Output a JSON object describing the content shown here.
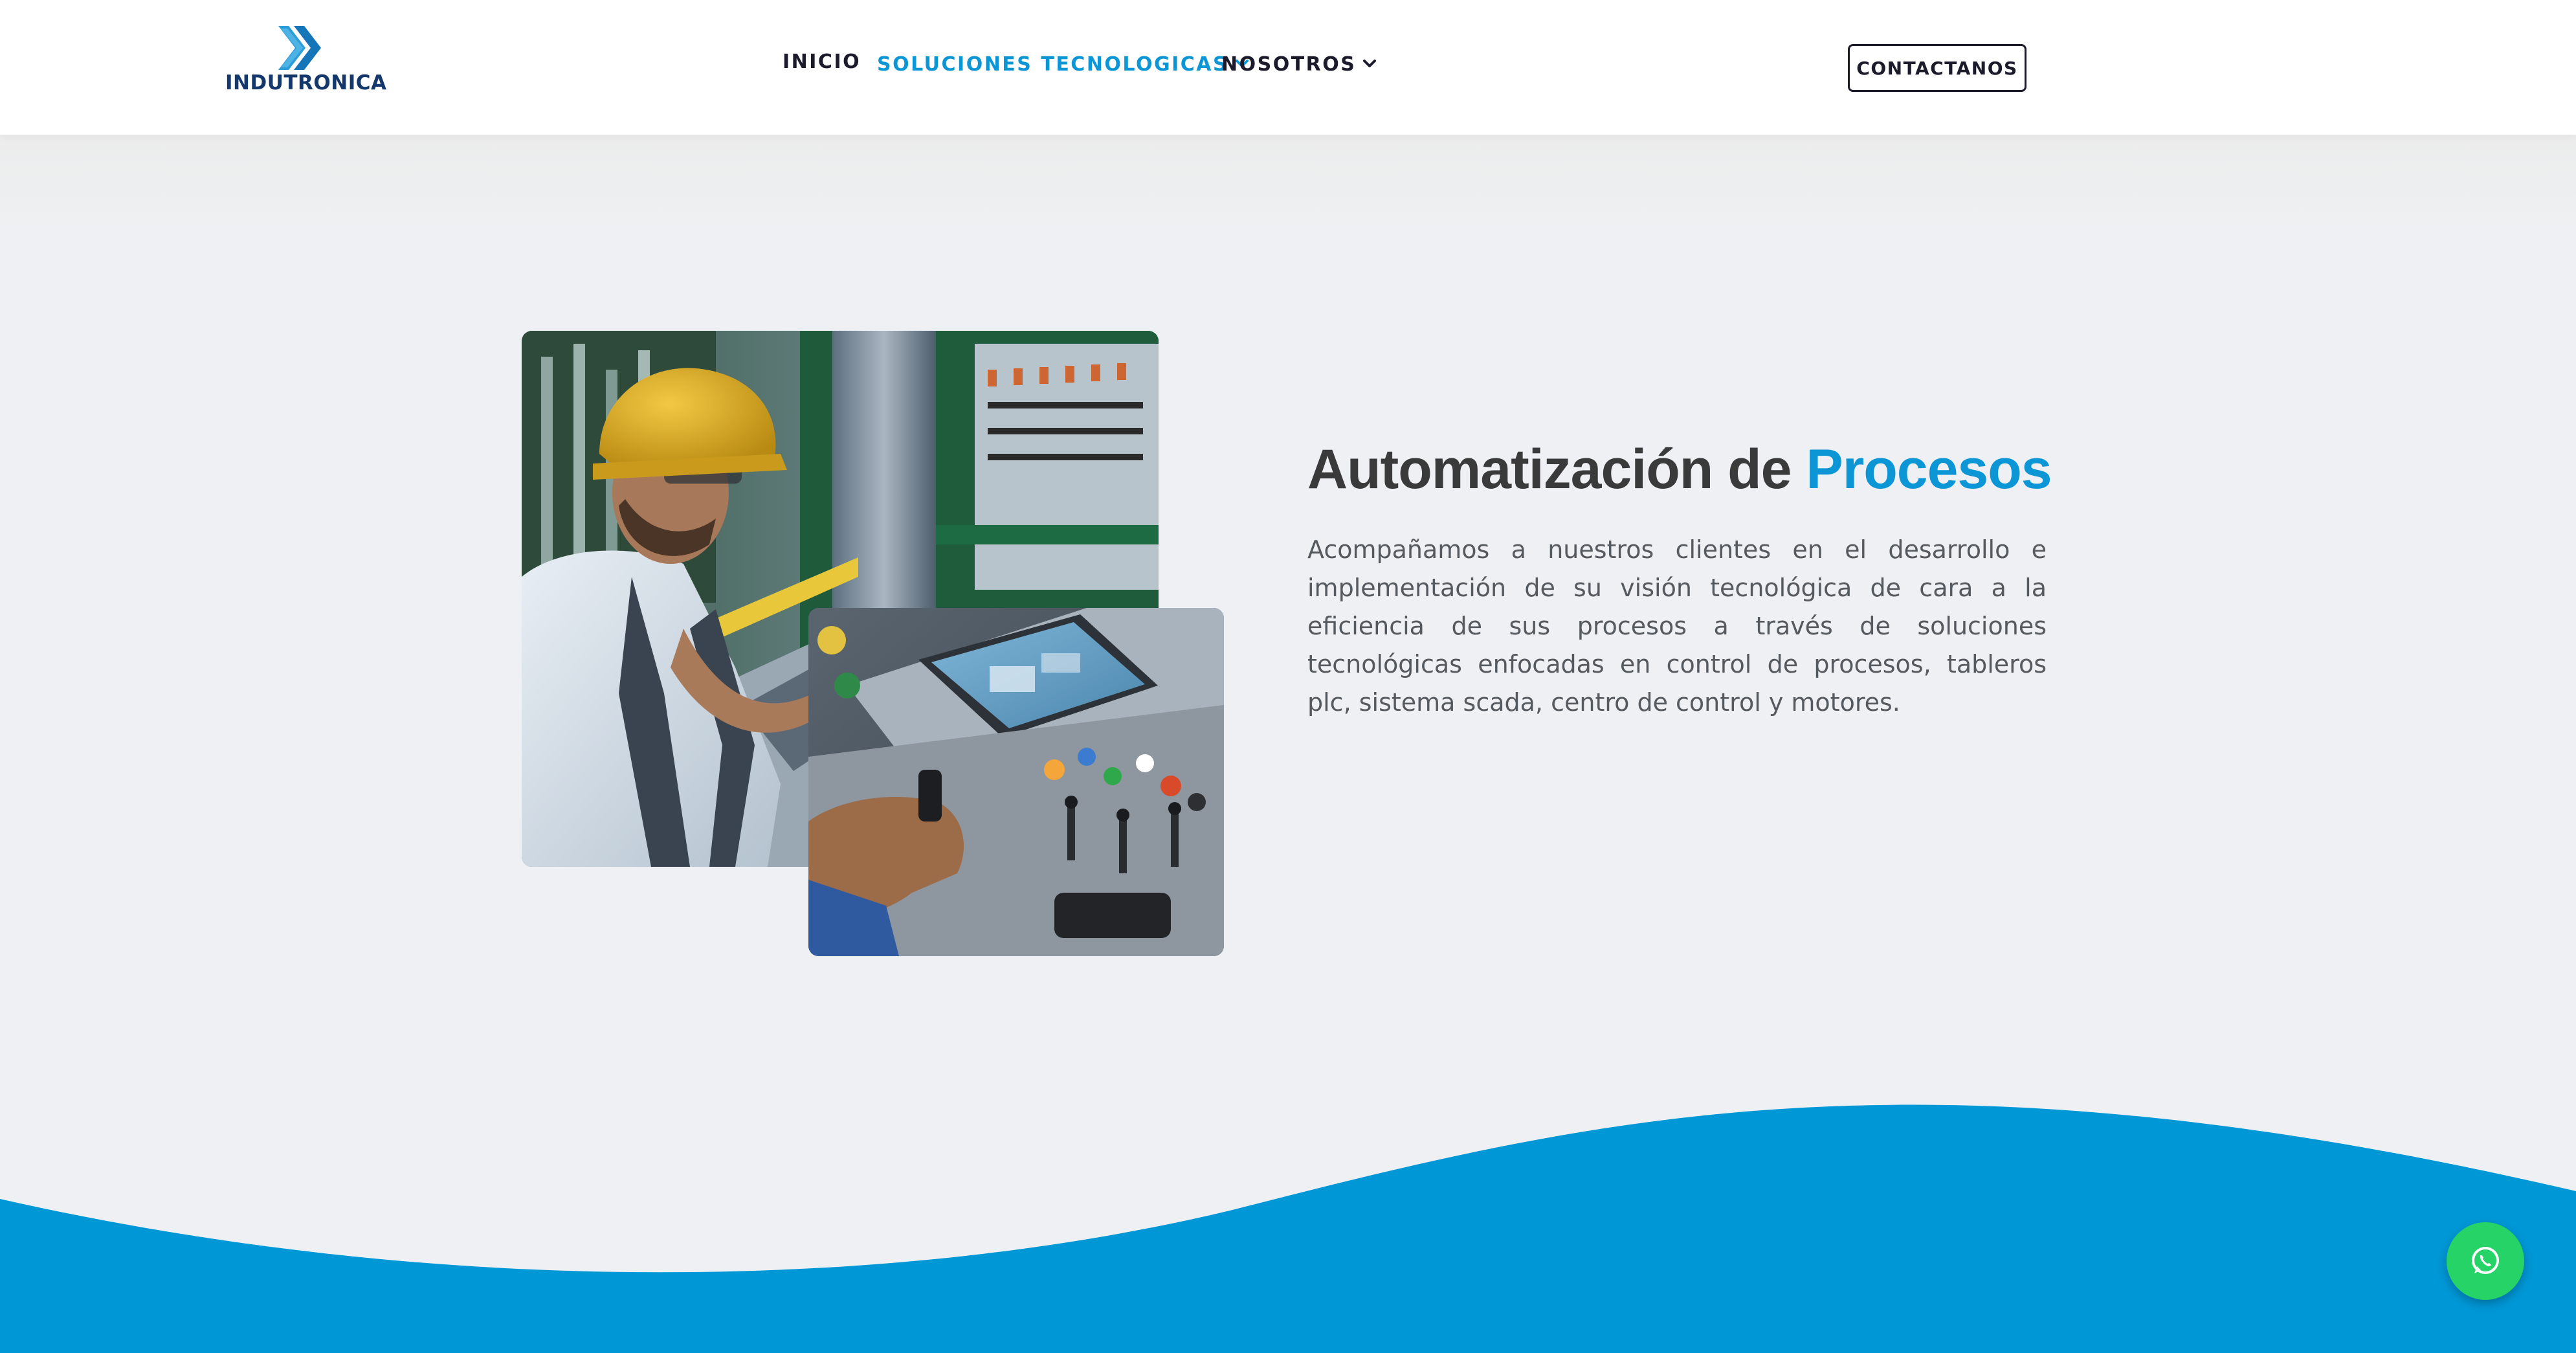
{
  "brand": {
    "name": "INDUTRONICA",
    "logo_icon": "double-chevron-logo-icon",
    "primary_color": "#0d96d6",
    "dark_color": "#14386b"
  },
  "nav": {
    "items": [
      {
        "label": "INICIO",
        "active": false,
        "has_dropdown": false
      },
      {
        "label": "SOLUCIONES TECNOLOGICAS",
        "active": true,
        "has_dropdown": true
      },
      {
        "label": "NOSOTROS",
        "active": false,
        "has_dropdown": true
      }
    ],
    "dropdown_icon": "chevron-down-icon"
  },
  "cta": {
    "label": "CONTACTANOS"
  },
  "hero": {
    "title_main": "Automatización de ",
    "title_accent": "Procesos",
    "description": "Acompañamos a nuestros clientes en el desarrollo e implementación de su visión tecnológica de cara a la eficiencia de sus procesos a través de soluciones tecnológicas enfocadas en control de procesos, tableros plc, sistema scada, centro de control y motores.",
    "images": [
      {
        "name": "worker-with-hard-hat-photo"
      },
      {
        "name": "control-panel-joystick-photo"
      }
    ]
  },
  "floating": {
    "whatsapp_icon": "whatsapp-icon",
    "whatsapp_color": "#25d366"
  },
  "wave_color": "#0097d6"
}
